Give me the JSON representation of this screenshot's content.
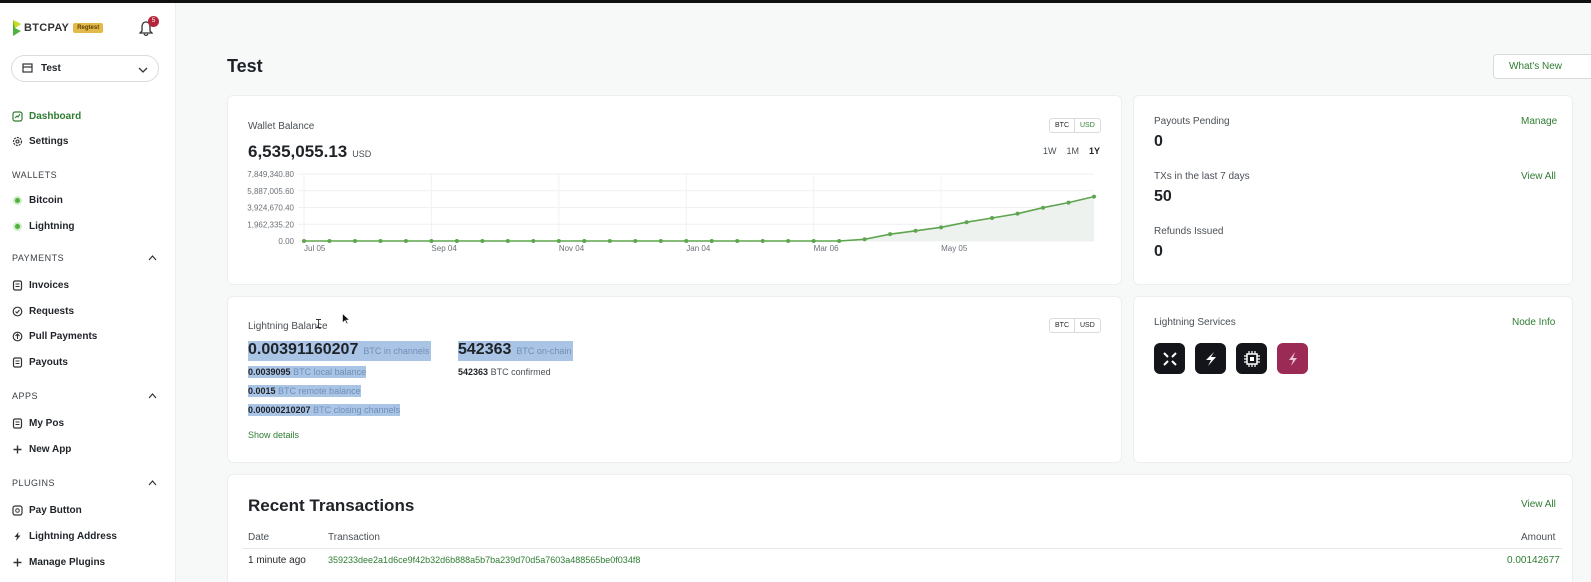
{
  "sidebar": {
    "logo_text": "BTCPAY",
    "network_badge": "Regtest",
    "notifications_count": "5",
    "store": "Test",
    "nav": {
      "dashboard": "Dashboard",
      "settings": "Settings",
      "wallets_header": "WALLETS",
      "bitcoin": "Bitcoin",
      "lightning": "Lightning",
      "payments_header": "PAYMENTS",
      "invoices": "Invoices",
      "requests": "Requests",
      "pull_payments": "Pull Payments",
      "payouts": "Payouts",
      "apps_header": "APPS",
      "my_pos": "My Pos",
      "new_app": "New App",
      "plugins_header": "PLUGINS",
      "pay_button": "Pay Button",
      "lightning_address": "Lightning Address",
      "manage_plugins": "Manage Plugins"
    }
  },
  "header": {
    "title": "Test",
    "whats_new": "What's New"
  },
  "wallet": {
    "label": "Wallet Balance",
    "amount": "6,535,055.13",
    "currency": "USD",
    "toggle": [
      "BTC",
      "USD"
    ],
    "ranges": [
      "1W",
      "1M",
      "1Y"
    ],
    "active_range": "1Y"
  },
  "chart_data": {
    "type": "area",
    "y_ticks": [
      "7,849,340.80",
      "5,887,005.60",
      "3,924,670.40",
      "1,962,335.20",
      "0.00"
    ],
    "x_ticks": [
      "Jul 05",
      "Sep 04",
      "Nov 04",
      "Jan 04",
      "Mar 06",
      "May 05"
    ],
    "ylim": [
      0,
      7849340.8
    ],
    "values": [
      0,
      0,
      0,
      0,
      0,
      0,
      0,
      0,
      0,
      0,
      0,
      0,
      0,
      0,
      0,
      0,
      0,
      0,
      0,
      0,
      0,
      0,
      200000,
      800000,
      1200000,
      1600000,
      2200000,
      2700000,
      3200000,
      3900000,
      4500000,
      5200000
    ],
    "color": "#5ea54f"
  },
  "summary": {
    "payouts_label": "Payouts Pending",
    "payouts_value": "0",
    "payouts_link": "Manage",
    "txs_label": "TXs in the last 7 days",
    "txs_value": "50",
    "txs_link": "View All",
    "refunds_label": "Refunds Issued",
    "refunds_value": "0"
  },
  "lightning": {
    "label": "Lightning Balance",
    "toggle": [
      "BTC",
      "USD"
    ],
    "channels_value": "0.00391160207",
    "channels_label": "BTC in channels",
    "onchain_value": "542363",
    "onchain_label": "BTC on-chain",
    "local_value": "0.0039095",
    "local_label": "BTC local balance",
    "remote_value": "0.0015",
    "remote_label": "BTC remote balance",
    "closing_value": "0.00000210207",
    "closing_label": "BTC closing channels",
    "confirmed_value": "542363",
    "confirmed_label": "BTC confirmed",
    "show_details": "Show details"
  },
  "services": {
    "label": "Lightning Services",
    "link": "Node Info"
  },
  "transactions": {
    "title": "Recent Transactions",
    "link": "View All",
    "columns": [
      "Date",
      "Transaction",
      "Amount"
    ],
    "rows": [
      {
        "date": "1 minute ago",
        "tx": "359233dee2a1d6ce9f42b32d6b888a5b7ba239d70d5a7603a488565be0f034f8",
        "amount": "0.00142677"
      }
    ]
  }
}
